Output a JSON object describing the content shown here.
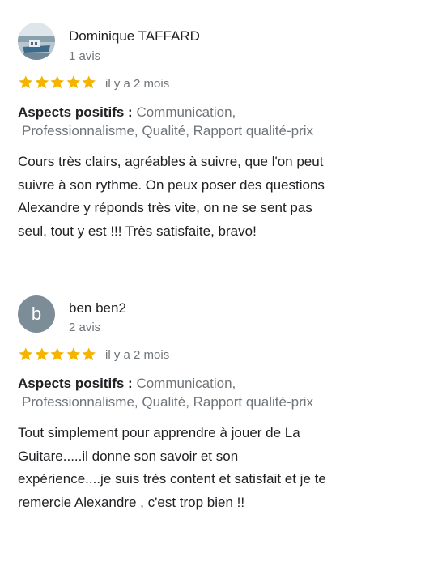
{
  "reviews": [
    {
      "author": "Dominique TAFFARD",
      "review_count": "1 avis",
      "rating": 5,
      "time": "il y a 2 mois",
      "aspects_label": "Aspects positifs :",
      "aspects_line1": "Communication,",
      "aspects_line2": "Professionnalisme, Qualité, Rapport qualité-prix",
      "text": "Cours très clairs, agréables à suivre, que l'on peut suivre à son rythme. On peux poser des questions Alexandre y réponds très vite, on ne se sent pas seul, tout y est !!! Très satisfaite, bravo!",
      "text_lines": [
        "Cours très clairs, agréables à suivre, que l'on peut",
        "suivre à son rythme. On peux poser des questions",
        "Alexandre y réponds très vite, on ne se sent pas",
        "seul, tout y est !!! Très satisfaite, bravo!"
      ]
    },
    {
      "author": "ben ben2",
      "avatar_letter": "b",
      "review_count": "2 avis",
      "rating": 5,
      "time": "il y a 2 mois",
      "aspects_label": "Aspects positifs :",
      "aspects_line1": "Communication,",
      "aspects_line2": "Professionnalisme, Qualité, Rapport qualité-prix",
      "text_lines": [
        "Tout simplement pour apprendre à jouer de La",
        "Guitare.....il donne son savoir et son",
        "expérience....je suis très content et satisfait et je te",
        "remercie Alexandre , c'est trop bien  !!"
      ]
    }
  ],
  "colors": {
    "star": "#f4b400",
    "secondary_text": "#70757a",
    "primary_text": "#202124",
    "avatar_letter_bg": "#7c8d98"
  },
  "icons": {
    "star": "star-icon",
    "avatar_photo": "avatar-photo"
  }
}
